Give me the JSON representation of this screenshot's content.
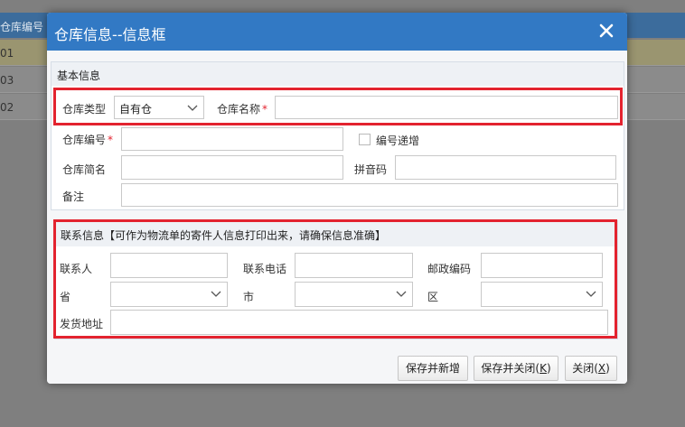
{
  "background": {
    "header": "仓库编号",
    "rows": [
      "01",
      "03",
      "02"
    ]
  },
  "dialog": {
    "title": "仓库信息--信息框",
    "close_icon": "close-icon"
  },
  "basic": {
    "title": "基本信息",
    "type_label": "仓库类型",
    "type_value": "自有仓",
    "name_label": "仓库名称",
    "name_value": "",
    "code_label": "仓库编号",
    "code_value": "",
    "auto_increment_label": "编号递增",
    "short_label": "仓库简名",
    "short_value": "",
    "pinyin_label": "拼音码",
    "pinyin_value": "",
    "note_label": "备注",
    "note_value": "",
    "required_mark": "*"
  },
  "contact": {
    "title": "联系信息【可作为物流单的寄件人信息打印出来，请确保信息准确】",
    "person_label": "联系人",
    "phone_label": "联系电话",
    "postcode_label": "邮政编码",
    "province_label": "省",
    "city_label": "市",
    "district_label": "区",
    "address_label": "发货地址"
  },
  "buttons": {
    "save_new": "保存并新增",
    "save_close": "保存并关闭",
    "save_close_key": "K",
    "close": "关闭",
    "close_key": "X"
  },
  "colors": {
    "titlebar": "#3279c4",
    "highlight": "#e3232f",
    "required": "#e3232f"
  }
}
